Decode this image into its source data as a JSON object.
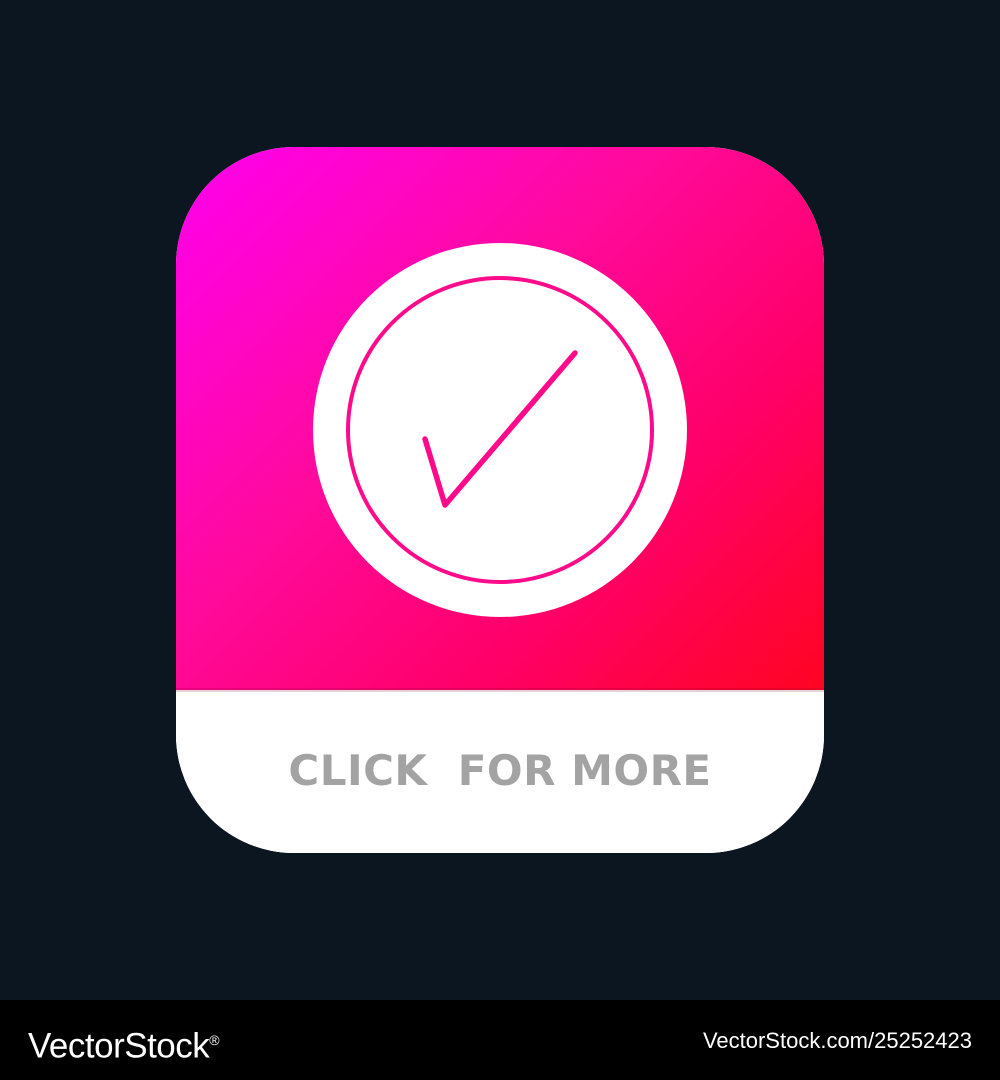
{
  "app_button": {
    "cta_label": "CLICK  FOR MORE",
    "icon": "checkmark-circle-icon",
    "gradient_colors": [
      "#ff00f0",
      "#ff0a9c",
      "#ff0068",
      "#ff0522"
    ],
    "icon_stroke_color": "#ff0a8a",
    "cta_color": "#a3a3a3",
    "tile_footer_color": "#ffffff"
  },
  "page": {
    "background_color": "#0b1620"
  },
  "watermark": {
    "brand": "VectorStock",
    "registered_mark": "®",
    "image_id": "VectorStock.com/25252423",
    "bar_color": "#000000"
  }
}
